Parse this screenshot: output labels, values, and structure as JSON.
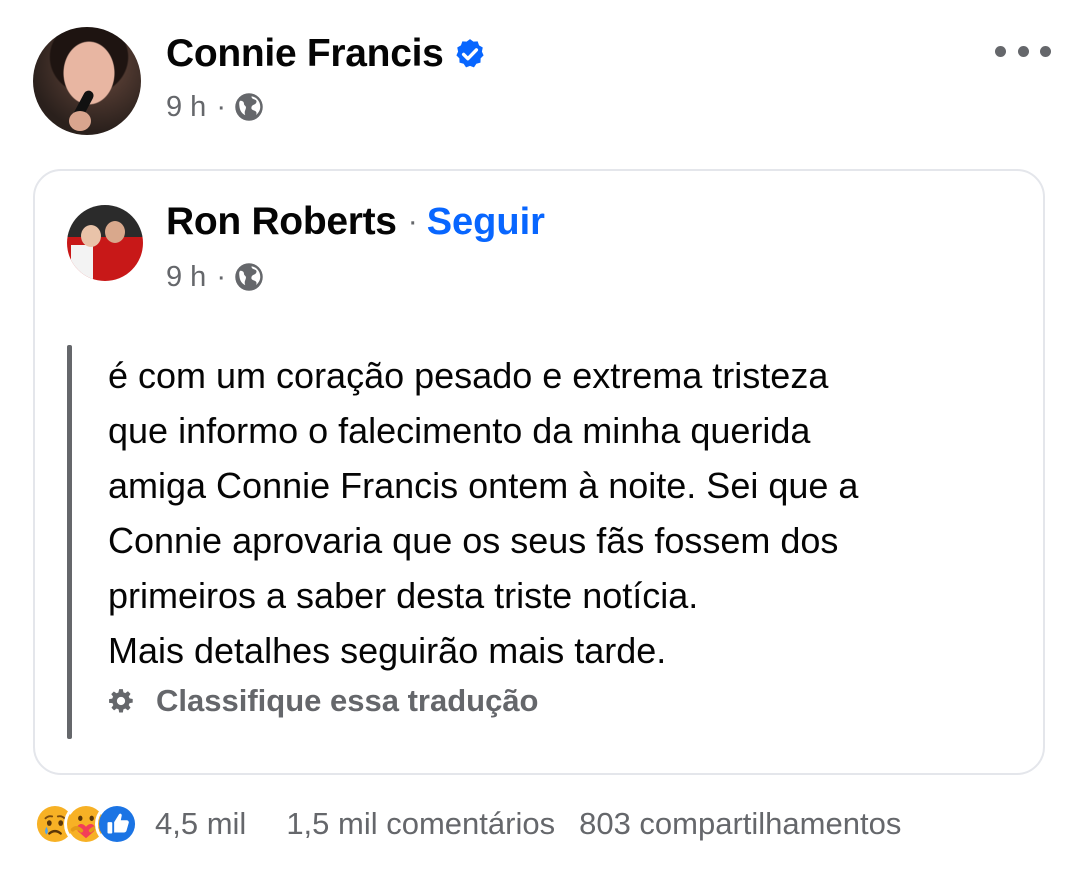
{
  "post": {
    "author": "Connie Francis",
    "time": "9 h",
    "separator": "·",
    "verified_icon": "verified-badge-icon",
    "audience_icon": "globe-icon",
    "more_icon": "more-options-icon"
  },
  "shared_post": {
    "author": "Ron Roberts",
    "follow_separator": "·",
    "follow_label": "Seguir",
    "time": "9 h",
    "separator": "·",
    "body_lines": [
      "é com um coração pesado e extrema tristeza",
      "que informo o falecimento da minha querida",
      "amiga Connie Francis ontem à noite. Sei que a",
      "Connie aprovaria que os seus fãs fossem dos",
      "primeiros a saber desta triste notícia.",
      "Mais detalhes seguirão mais tarde."
    ],
    "translation_label": "Classifique essa tradução"
  },
  "footer": {
    "reactions": [
      "sad-reaction-icon",
      "care-reaction-icon",
      "like-reaction-icon"
    ],
    "reaction_count": "4,5 mil",
    "comments": "1,5 mil comentários",
    "shares": "803 compartilhamentos"
  },
  "colors": {
    "link": "#0866ff",
    "secondary_text": "#65676b",
    "border": "#e4e6eb"
  }
}
